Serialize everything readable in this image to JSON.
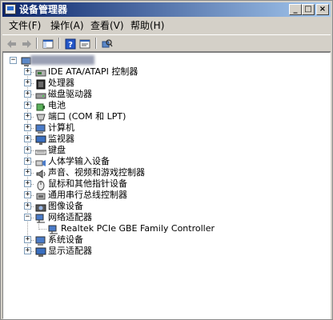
{
  "window": {
    "title": "设备管理器",
    "controls": {
      "minimize": "_",
      "maximize": "□",
      "close": "×"
    }
  },
  "menu": [
    {
      "label": "文件(F)"
    },
    {
      "label": "操作(A)"
    },
    {
      "label": "查看(V)"
    },
    {
      "label": "帮助(H)"
    }
  ],
  "toolbar": {
    "icons": [
      "back-arrow-icon",
      "forward-arrow-icon",
      "show-hide-console-tree-icon",
      "help-icon",
      "properties-icon",
      "scan-hardware-icon"
    ]
  },
  "tree": {
    "root": {
      "label": "",
      "expander": "−"
    },
    "items": [
      {
        "label": "IDE ATA/ATAPI 控制器",
        "expander": "+",
        "icon": "ide-controller-icon"
      },
      {
        "label": "处理器",
        "expander": "+",
        "icon": "processor-icon"
      },
      {
        "label": "磁盘驱动器",
        "expander": "+",
        "icon": "disk-drive-icon"
      },
      {
        "label": "电池",
        "expander": "+",
        "icon": "battery-icon"
      },
      {
        "label": "端口 (COM 和 LPT)",
        "expander": "+",
        "icon": "port-icon"
      },
      {
        "label": "计算机",
        "expander": "+",
        "icon": "computer-icon"
      },
      {
        "label": "监视器",
        "expander": "+",
        "icon": "monitor-icon"
      },
      {
        "label": "键盘",
        "expander": "+",
        "icon": "keyboard-icon"
      },
      {
        "label": "人体学输入设备",
        "expander": "+",
        "icon": "hid-icon"
      },
      {
        "label": "声音、视频和游戏控制器",
        "expander": "+",
        "icon": "sound-icon"
      },
      {
        "label": "鼠标和其他指针设备",
        "expander": "+",
        "icon": "mouse-icon"
      },
      {
        "label": "通用串行总线控制器",
        "expander": "+",
        "icon": "usb-icon"
      },
      {
        "label": "图像设备",
        "expander": "+",
        "icon": "camera-icon"
      },
      {
        "label": "网络适配器",
        "expander": "−",
        "icon": "network-adapter-icon",
        "children": [
          {
            "label": "Realtek PCIe GBE Family Controller",
            "icon": "network-card-icon"
          }
        ]
      },
      {
        "label": "系统设备",
        "expander": "+",
        "icon": "system-device-icon"
      },
      {
        "label": "显示适配器",
        "expander": "+",
        "icon": "display-adapter-icon"
      }
    ]
  },
  "colors": {
    "titlebar_start": "#0a246a",
    "titlebar_end": "#a6caf0",
    "chrome": "#d4d0c8"
  }
}
